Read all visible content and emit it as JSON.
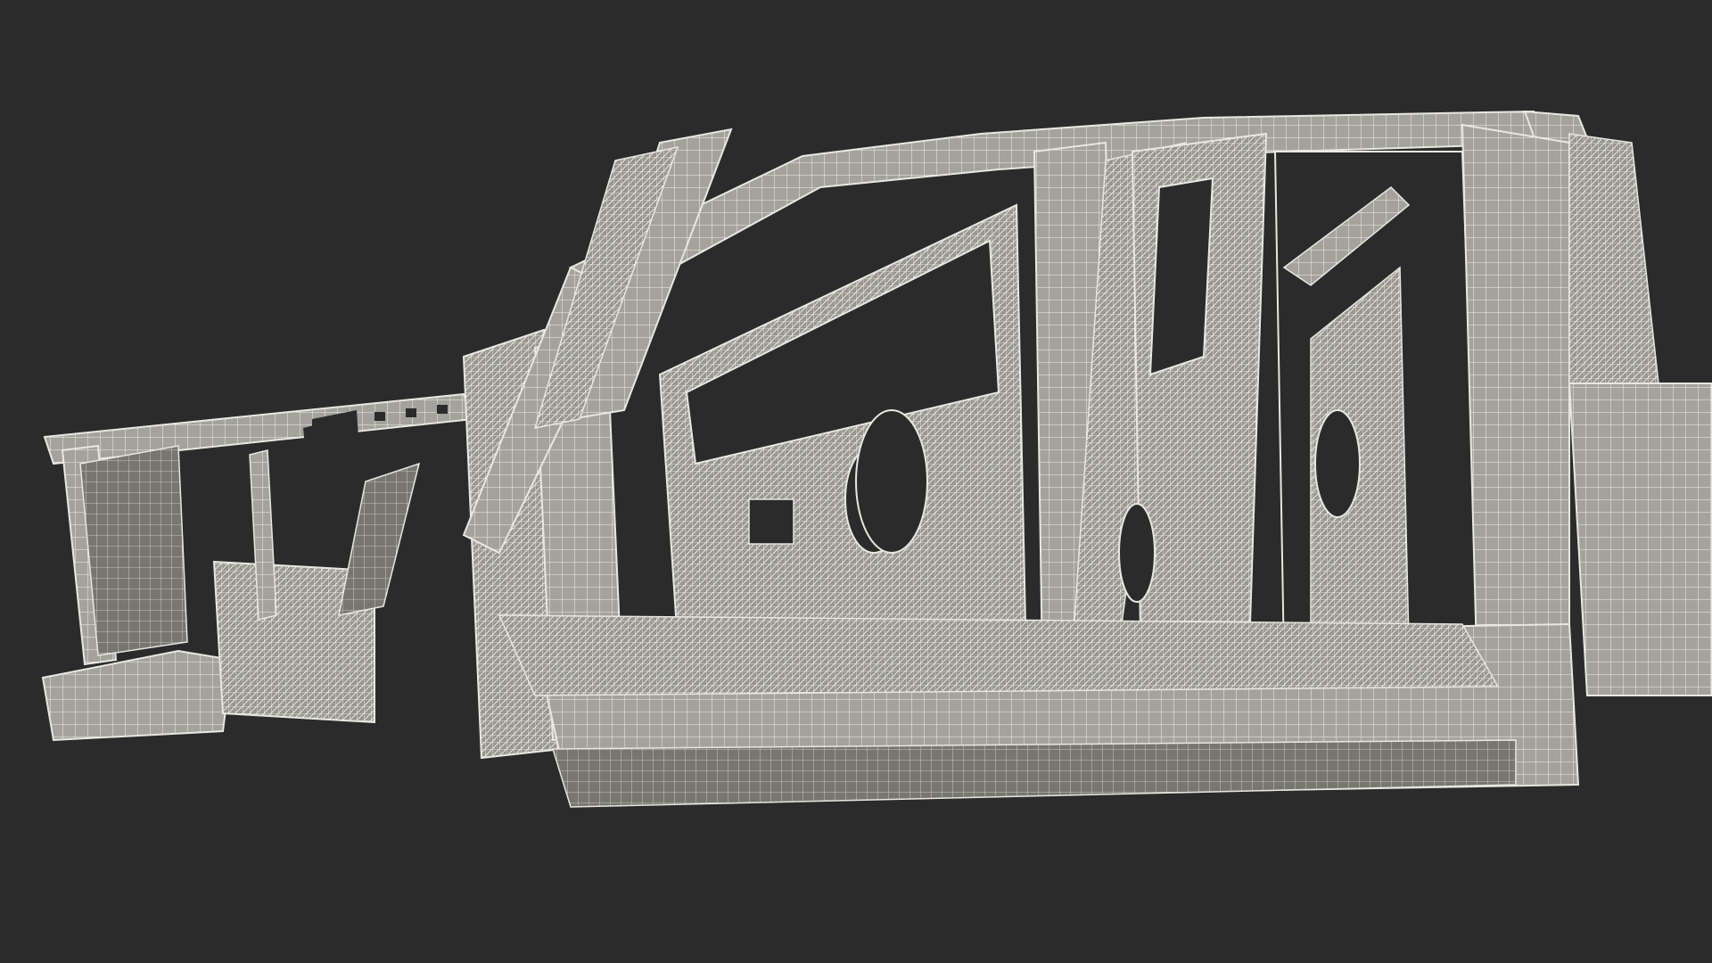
{
  "scene": {
    "subject": "pickup-truck-body-in-white-wireframe",
    "background_color": "#2b2b2b",
    "surface_color": "#a3a39c",
    "surface_shadow_color": "#6e6e68",
    "wire_color": "#f4f4ee",
    "hole_color": "#2b2b2b"
  }
}
